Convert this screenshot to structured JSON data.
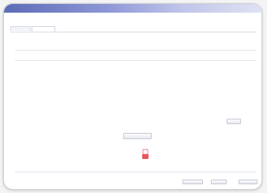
{
  "window": {
    "title": "",
    "header_title": "",
    "help_label": "",
    "accent_color": "#5b7fc9"
  },
  "tabs": [
    {
      "label": ""
    },
    {
      "label": ""
    }
  ],
  "sub_link": "",
  "description": "",
  "table": {
    "columns": [
      "",
      ""
    ],
    "rows": [
      {
        "number": "",
        "task": ""
      },
      {
        "number": "",
        "task": ""
      },
      {
        "number": "",
        "task": ""
      },
      {
        "number": "",
        "task": ""
      },
      {
        "number": "",
        "task": ""
      }
    ]
  },
  "buttons": {
    "small_label": "",
    "center_label": "",
    "back_label": "",
    "next_label": "",
    "cancel_label": ""
  },
  "footer_link": "",
  "icons": {
    "cursor": "pointer-cursor-icon",
    "close": "close-icon"
  }
}
